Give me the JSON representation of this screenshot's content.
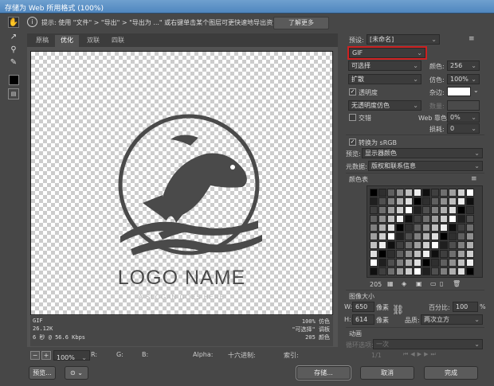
{
  "window": {
    "title": "存储为 Web 所用格式 (100%)"
  },
  "hint": {
    "text": "提示: 使用 \"文件\" > \"导出\" > \"导出为 ...\" 或右键单击某个图层可更快速地导出资源",
    "learn_more": "了解更多"
  },
  "tabs": [
    "原稿",
    "优化",
    "双联",
    "四联"
  ],
  "active_tab": "优化",
  "canvas": {
    "logo_name": "LOGO NAME",
    "slogan": "A SLOGAN GOES HERE"
  },
  "info": {
    "format": "GIF",
    "size": "26.12K",
    "time": "6 秒 @ 56.6 Kbps",
    "dither_pct": "100% 仿色",
    "palette": "\"可选择\" 调板",
    "colors": "205 颜色"
  },
  "status": {
    "zoom": "100%",
    "r": "R:",
    "g": "G:",
    "b": "B:",
    "alpha": "Alpha:",
    "hex": "十六进制:",
    "index": "索引:"
  },
  "preset": {
    "label": "预设:",
    "value": "[未命名]"
  },
  "settings": {
    "format": "GIF",
    "reduction": "可选择",
    "colors_label": "颜色:",
    "colors_value": "256",
    "dither_algo": "扩散",
    "dither_label": "仿色:",
    "dither_value": "100%",
    "transparency": "透明度",
    "matte_label": "杂边:",
    "trans_dither": "无透明度仿色",
    "amount_label": "数量:",
    "interlaced": "交错",
    "web_snap_label": "Web 靠色:",
    "web_snap_value": "0%",
    "lossy_label": "损耗:",
    "lossy_value": "0",
    "convert_srgb": "转换为 sRGB",
    "preview_label": "预览:",
    "preview_value": "显示器颜色",
    "metadata_label": "元数据:",
    "metadata_value": "版权和联系信息"
  },
  "color_table": {
    "title": "颜色表",
    "count": "205"
  },
  "image_size": {
    "title": "图像大小",
    "w_label": "W:",
    "w_value": "650",
    "h_label": "H:",
    "h_value": "614",
    "px": "像素",
    "percent_label": "百分比:",
    "percent_value": "100",
    "pct": "%",
    "quality_label": "品质:",
    "quality_value": "两次立方"
  },
  "animation": {
    "title": "动画",
    "loop_label": "循环选项:",
    "loop_value": "一次",
    "frame": "1/1"
  },
  "buttons": {
    "preview": "预览...",
    "save": "存储...",
    "cancel": "取消",
    "done": "完成"
  },
  "colors": {
    "highlight_red": "#cc2222",
    "logo_gray": "#4a4a4a",
    "panel_bg": "#474747"
  }
}
